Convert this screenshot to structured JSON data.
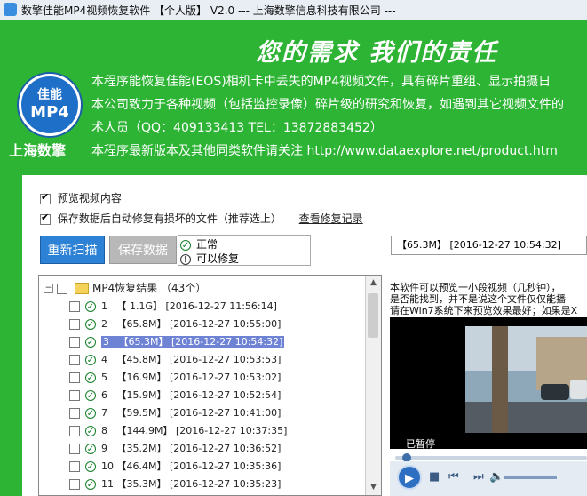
{
  "window": {
    "title": "数擎佳能MP4视频恢复软件  【个人版】 V2.0  --- 上海数擎信息科技有限公司 ---"
  },
  "header": {
    "slogan": "您的需求   我们的责任",
    "logo_line1": "佳能",
    "logo_line2": "MP4",
    "company_name": "上海数擎",
    "info_lines": [
      "本程序能恢复佳能(EOS)相机卡中丢失的MP4视频文件，具有碎片重组、显示拍摄日",
      "本公司致力于各种视频（包括监控录像）碎片级的研究和恢复，如遇到其它视频文件的",
      "术人员（QQ：409133413  TEL：13872883452）",
      "本程序最新版本及其他同类软件请关注 http://www.dataexplore.net/product.htm"
    ]
  },
  "options": {
    "preview_label": "预览视频内容",
    "autofix_label": "保存数据后自动修复有损坏的文件（推荐选上）",
    "log_label": "查看修复记录"
  },
  "buttons": {
    "rescan": "重新扫描",
    "save": "保存数据"
  },
  "status_legend": {
    "normal": "正常",
    "repairable": "可以修复"
  },
  "tree": {
    "root_label": "MP4恢复结果  （43个）",
    "rows": [
      {
        "num": "1",
        "size": "【 1.1G】",
        "time": "[2016-12-27 11:56:14]"
      },
      {
        "num": "2",
        "size": "【65.8M】",
        "time": "[2016-12-27 10:55:00]"
      },
      {
        "num": "3",
        "size": "【65.3M】",
        "time": "[2016-12-27 10:54:32]"
      },
      {
        "num": "4",
        "size": "【45.8M】",
        "time": "[2016-12-27 10:53:53]"
      },
      {
        "num": "5",
        "size": "【16.9M】",
        "time": "[2016-12-27 10:53:02]"
      },
      {
        "num": "6",
        "size": "【15.9M】",
        "time": "[2016-12-27 10:52:54]"
      },
      {
        "num": "7",
        "size": "【59.5M】",
        "time": "[2016-12-27 10:41:00]"
      },
      {
        "num": "8",
        "size": "【144.9M】",
        "time": "[2016-12-27 10:37:35]"
      },
      {
        "num": "9",
        "size": "【35.2M】",
        "time": "[2016-12-27 10:36:52]"
      },
      {
        "num": "10",
        "size": "【46.4M】",
        "time": "[2016-12-27 10:35:36]"
      },
      {
        "num": "11",
        "size": "【35.3M】",
        "time": "[2016-12-27 10:35:23]"
      }
    ],
    "selected_index": 2
  },
  "preview": {
    "title": "【65.3M】 [2016-12-27 10:54:32]",
    "desc_lines": [
      "本软件可以预览一小段视频（几秒钟），",
      "是否能找到，并不是说这个文件仅仅能播",
      "请在Win7系统下来预览效果最好；如果是X"
    ],
    "status": "已暂停"
  },
  "colors": {
    "brand_green": "#2db434",
    "selected_row": "#6f83d4",
    "rescan_blue": "#2e82d6"
  }
}
